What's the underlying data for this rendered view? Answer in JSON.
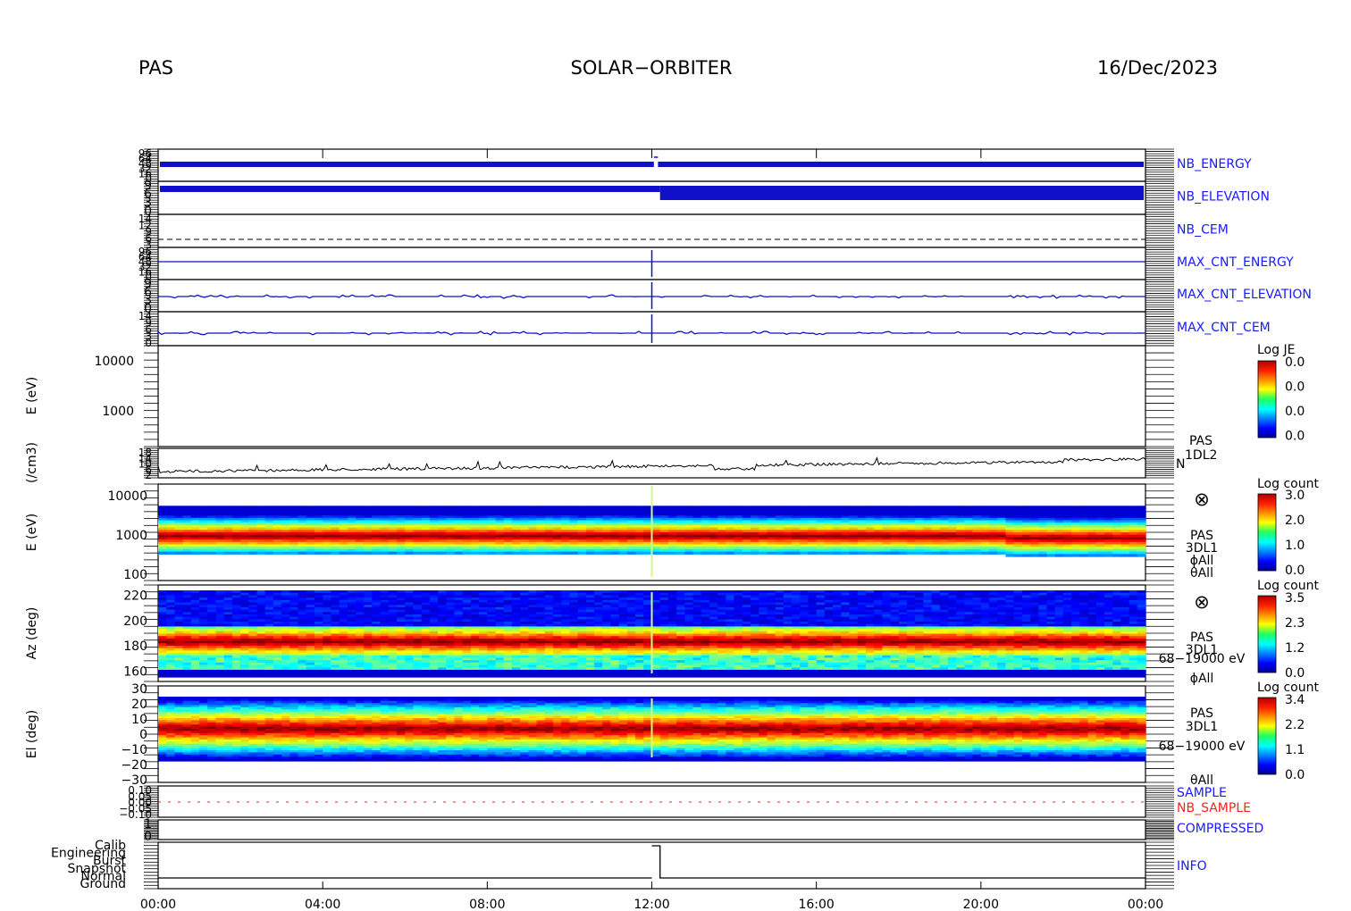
{
  "header": {
    "left": "PAS",
    "center": "SOLAR−ORBITER",
    "right": "16/Dec/2023"
  },
  "colors": {
    "trace_blue": "#1010c8",
    "sample_red": "#ff2020",
    "text_blue": "#1a1aff"
  },
  "chart_data": [
    {
      "type": "line",
      "panel": "nb-energy",
      "right_label": "NB_ENERGY",
      "yticks": [
        "96",
        "64",
        "48",
        "32",
        "16",
        "0"
      ],
      "segments": [
        {
          "x_hours": [
            0,
            12.05
          ],
          "y_level": 0.75
        },
        {
          "x_hours": [
            12.05,
            24
          ],
          "y_level": 0.75
        }
      ]
    },
    {
      "type": "line",
      "panel": "nb-elevation",
      "right_label": "NB_ELEVATION",
      "yticks": [
        "9",
        "6",
        "3",
        "0"
      ],
      "note_hours_change": 12.2
    },
    {
      "type": "line",
      "panel": "nb-cem",
      "right_label": "NB_CEM",
      "yticks": [
        "14",
        "12",
        "9",
        "6",
        "3"
      ]
    },
    {
      "type": "line",
      "panel": "max-cnt-energy",
      "right_label": "MAX_CNT_ENERGY",
      "yticks": [
        "96",
        "64",
        "48",
        "32",
        "16",
        "0"
      ]
    },
    {
      "type": "line",
      "panel": "max-cnt-elevation",
      "right_label": "MAX_CNT_ELEVATION",
      "yticks": [
        "9",
        "6",
        "3",
        "0"
      ]
    },
    {
      "type": "line",
      "panel": "max-cnt-cem",
      "right_label": "MAX_CNT_CEM",
      "yticks": [
        "14",
        "9",
        "6",
        "3",
        "0"
      ]
    },
    {
      "type": "heatmap",
      "panel": "ion-energy-l2",
      "ylabel": "E (eV)",
      "yscale": "log",
      "ylim": [
        300,
        20000
      ],
      "yticks": [
        "10000",
        "1000"
      ],
      "colorbar": {
        "title": "Log JE",
        "ticks": [
          "0.0",
          "0.0",
          "0.0",
          "0.0"
        ]
      },
      "empty": true
    },
    {
      "type": "line",
      "panel": "density",
      "ylabel": "(/cm3)",
      "right_label": "N",
      "side_text": [
        "PAS",
        "1DL2"
      ],
      "yticks": [
        "18",
        "14",
        "10",
        "6",
        "2"
      ]
    },
    {
      "type": "heatmap",
      "panel": "energy-spectrogram",
      "ylabel": "E (eV)",
      "yscale": "log",
      "ylim": [
        70,
        20000
      ],
      "yticks": [
        "10000",
        "1000",
        "100"
      ],
      "colorbar": {
        "title": "Log count",
        "ticks": [
          "3.0",
          "2.0",
          "1.0",
          "0.0"
        ]
      },
      "side_text": [
        "PAS",
        "3DL1",
        "ϕAll",
        "θAll"
      ],
      "peak_energy_ev": 950,
      "shift_hours": 20.5
    },
    {
      "type": "heatmap",
      "panel": "azimuth-spectrogram",
      "ylabel": "Az (deg)",
      "ylim": [
        152,
        228
      ],
      "yticks": [
        "220",
        "200",
        "180",
        "160"
      ],
      "colorbar": {
        "title": "Log count",
        "ticks": [
          "3.5",
          "2.3",
          "1.2",
          "0.0"
        ]
      },
      "side_text": [
        "PAS",
        "3DL1",
        "68−19000 eV",
        "ϕAll"
      ],
      "peak_az_deg": 183
    },
    {
      "type": "heatmap",
      "panel": "elevation-spectrogram",
      "ylabel": "El (deg)",
      "ylim": [
        -30,
        30
      ],
      "yticks": [
        "30",
        "20",
        "10",
        "0",
        "−10",
        "−20",
        "−30"
      ],
      "colorbar": {
        "title": "Log count",
        "ticks": [
          "3.4",
          "2.2",
          "1.1",
          "0.0"
        ]
      },
      "side_text": [
        "PAS",
        "3DL1",
        "68−19000 eV",
        "θAll"
      ],
      "peak_el_deg": 0
    },
    {
      "type": "line",
      "panel": "sample",
      "right_label": "SAMPLE",
      "right_label_2": "NB_SAMPLE",
      "yticks": [
        "0.10",
        "0.05",
        "0.00",
        "−0.05",
        "−0.10"
      ]
    },
    {
      "type": "line",
      "panel": "compressed",
      "right_label": "COMPRESSED",
      "yticks": [
        "1",
        "0"
      ]
    },
    {
      "type": "line",
      "panel": "info",
      "right_label": "INFO",
      "yticks": [
        "Calib",
        "Engineering",
        "Burst",
        "Snapshot",
        "Normal",
        "Ground"
      ],
      "step": [
        {
          "x_hours": [
            0,
            12.0
          ],
          "mode": "Calib"
        },
        {
          "x_hours": [
            12.0,
            12.2
          ],
          "mode": "Calib"
        },
        {
          "x_hours": [
            12.2,
            24
          ],
          "mode": "Ground"
        }
      ]
    }
  ],
  "xaxis": {
    "ticks": [
      "00:00",
      "04:00",
      "08:00",
      "12:00",
      "16:00",
      "20:00",
      "00:00"
    ]
  }
}
